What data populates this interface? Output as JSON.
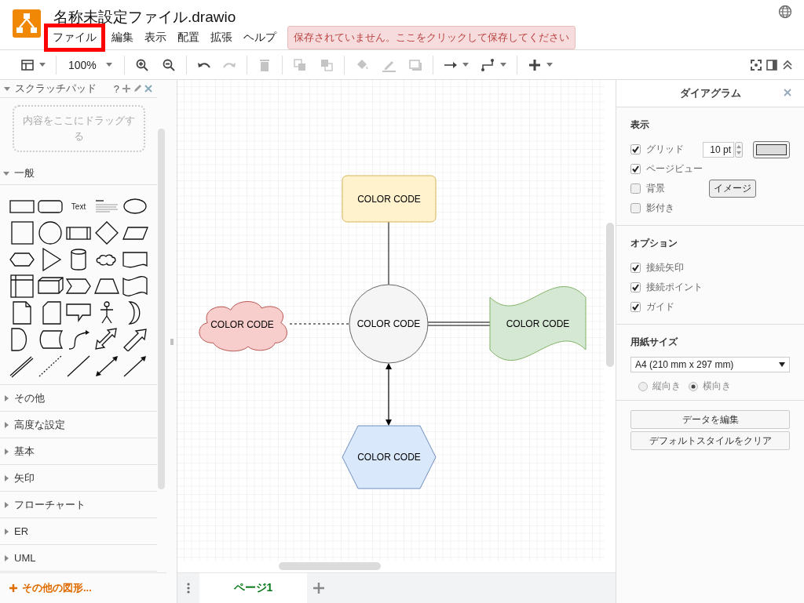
{
  "app": {
    "title": "名称未設定ファイル.drawio"
  },
  "menu": [
    {
      "label": "ファイル",
      "highlighted": true
    },
    {
      "label": "編集",
      "highlighted": false
    },
    {
      "label": "表示",
      "highlighted": false
    },
    {
      "label": "配置",
      "highlighted": false
    },
    {
      "label": "拡張",
      "highlighted": false
    },
    {
      "label": "ヘルプ",
      "highlighted": false
    }
  ],
  "save_notice": "保存されていません。ここをクリックして保存してください",
  "toolbar": {
    "zoom": "100%",
    "tools": [
      {
        "kind": "layout",
        "disabled": false
      },
      {
        "kind": "zoom",
        "disabled": false
      },
      {
        "kind": "zoom-in",
        "disabled": false
      },
      {
        "kind": "zoom-out",
        "disabled": false
      },
      {
        "kind": "undo",
        "disabled": false
      },
      {
        "kind": "redo",
        "disabled": true
      },
      {
        "kind": "delete",
        "disabled": true
      },
      {
        "kind": "to-front",
        "disabled": true
      },
      {
        "kind": "to-back",
        "disabled": true
      },
      {
        "kind": "fill",
        "disabled": true
      },
      {
        "kind": "line-color",
        "disabled": true
      },
      {
        "kind": "shadow",
        "disabled": true
      },
      {
        "kind": "connection",
        "disabled": false
      },
      {
        "kind": "waypoints",
        "disabled": false
      },
      {
        "kind": "insert",
        "disabled": false
      }
    ]
  },
  "sidebar": {
    "scratchpad": {
      "title": "スクラッチパッド",
      "hint": "?",
      "drop_hint": "内容をここにドラッグする"
    },
    "palette_text": "Text",
    "sections": [
      {
        "title": "一般",
        "expanded": true
      },
      {
        "title": "その他",
        "expanded": false
      },
      {
        "title": "高度な設定",
        "expanded": false
      },
      {
        "title": "基本",
        "expanded": false
      },
      {
        "title": "矢印",
        "expanded": false
      },
      {
        "title": "フローチャート",
        "expanded": false
      },
      {
        "title": "ER",
        "expanded": false
      },
      {
        "title": "UML",
        "expanded": false
      }
    ],
    "more_shapes": "その他の図形..."
  },
  "diagram": {
    "nodes": [
      {
        "kind": "rectangle",
        "label": "COLOR CODE",
        "color": "#fff2cc"
      },
      {
        "kind": "cloud",
        "label": "COLOR CODE",
        "color": "#f8cecc"
      },
      {
        "kind": "circle",
        "label": "COLOR CODE",
        "color": "#f5f5f5"
      },
      {
        "kind": "tape",
        "label": "COLOR CODE",
        "color": "#d5e8d4"
      },
      {
        "kind": "hexagon",
        "label": "COLOR CODE",
        "color": "#dae8fc"
      }
    ],
    "edges": [
      {
        "kind": "solid"
      },
      {
        "kind": "dashed"
      },
      {
        "kind": "double"
      },
      {
        "kind": "bidirectional"
      }
    ]
  },
  "page_tabs": [
    {
      "label": "ページ1",
      "selected": true
    }
  ],
  "format_panel": {
    "title": "ダイアグラム",
    "view": {
      "title": "表示",
      "options": [
        {
          "kind": "grid",
          "label": "グリッド",
          "checked": true
        },
        {
          "kind": "plain",
          "label": "ページビュー",
          "checked": true
        },
        {
          "kind": "background",
          "label": "背景",
          "checked": false
        },
        {
          "kind": "plain",
          "label": "影付き",
          "checked": false
        }
      ],
      "grid_size": "10 pt",
      "image_button": "イメージ"
    },
    "options": {
      "title": "オプション",
      "options": [
        {
          "label": "接続矢印",
          "checked": true
        },
        {
          "label": "接続ポイント",
          "checked": true
        },
        {
          "label": "ガイド",
          "checked": true
        }
      ]
    },
    "paper": {
      "title": "用紙サイズ",
      "size": "A4 (210 mm x 297 mm)",
      "orientations": [
        {
          "label": "縦向き",
          "selected": false
        },
        {
          "label": "横向き",
          "selected": true
        }
      ]
    },
    "buttons": [
      "データを編集",
      "デフォルトスタイルをクリア"
    ]
  }
}
